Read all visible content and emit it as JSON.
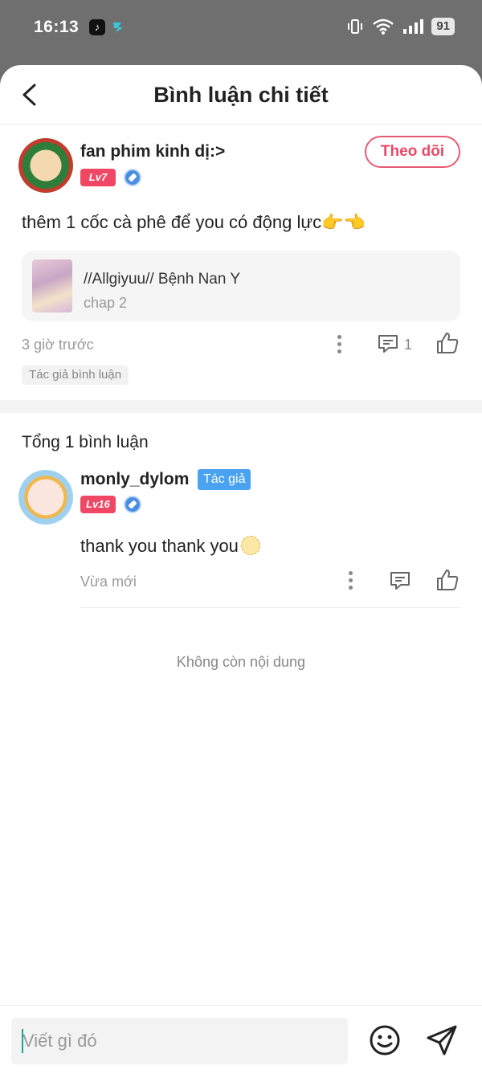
{
  "status_bar": {
    "time": "16:13",
    "battery": "91",
    "icons": [
      "tiktok-icon",
      "app-icon",
      "vibrate-icon",
      "wifi-icon",
      "signal-icon",
      "battery-icon"
    ]
  },
  "header": {
    "title": "Bình luận chi tiết",
    "back_icon": "back-arrow-icon"
  },
  "post": {
    "username": "fan phim kinh dị:>",
    "level": "Lv7",
    "follow_label": "Theo dõi",
    "content": "thêm 1 cốc cà phê để you có động lực👉👈",
    "comic": {
      "title": "//Allgiyuu// Bệnh Nan Y",
      "chapter": "chap 2"
    },
    "time": "3 giờ trước",
    "comment_count": "1",
    "author_commented": "Tác giả bình luận"
  },
  "replies": {
    "total_label": "Tổng 1 bình luận",
    "items": [
      {
        "username": "monly_dylom",
        "author_tag": "Tác giả",
        "level": "Lv16",
        "content": "thank you thank you",
        "time": "Vừa mới"
      }
    ],
    "end_label": "Không còn nội dung"
  },
  "input": {
    "placeholder": "Viết gì đó"
  },
  "colors": {
    "accent_pink": "#e84a66",
    "level_badge": "#f04864",
    "author_tag": "#4aa3f0"
  }
}
